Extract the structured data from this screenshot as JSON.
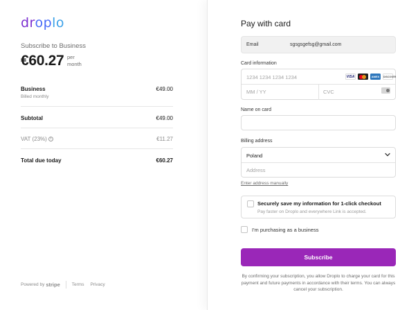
{
  "brand": {
    "logo_text": "droplo"
  },
  "summary": {
    "subscribe_label": "Subscribe to Business",
    "price": "€60.27",
    "per_line1": "per",
    "per_line2": "month",
    "items": [
      {
        "name": "Business",
        "sub": "Billed monthly",
        "amount": "€49.00"
      }
    ],
    "subtotal_label": "Subtotal",
    "subtotal_amount": "€49.00",
    "vat_label": "VAT (23%)",
    "vat_amount": "€11.27",
    "total_label": "Total due today",
    "total_amount": "€60.27"
  },
  "footer": {
    "powered_by": "Powered by",
    "stripe": "stripe",
    "terms": "Terms",
    "privacy": "Privacy"
  },
  "payment": {
    "title": "Pay with card",
    "email_label": "Email",
    "email_value": "sgsgsgefsg@gmail.com",
    "card_info_label": "Card information",
    "card_number_placeholder": "1234 1234 1234 1234",
    "expiry_placeholder": "MM / YY",
    "cvc_placeholder": "CVC",
    "card_brands": [
      "VISA",
      "mastercard",
      "AMEX",
      "DISCOVER"
    ],
    "name_label": "Name on card",
    "name_value": "",
    "billing_label": "Billing address",
    "country": "Poland",
    "address_placeholder": "Address",
    "enter_manually": "Enter address manually",
    "save_title": "Securely save my information for 1-click checkout",
    "save_sub": "Pay faster on Droplo and everywhere Link is accepted.",
    "business_label": "I'm purchasing as a business",
    "subscribe_button": "Subscribe",
    "legal": "By confirming your subscription, you allow Droplo to charge your card for this payment and future payments in accordance with their terms. You can always cancel your subscription."
  },
  "colors": {
    "accent": "#9a27b8",
    "logo_purple": "#7b2fd0",
    "logo_blue": "#4a6cf7"
  }
}
